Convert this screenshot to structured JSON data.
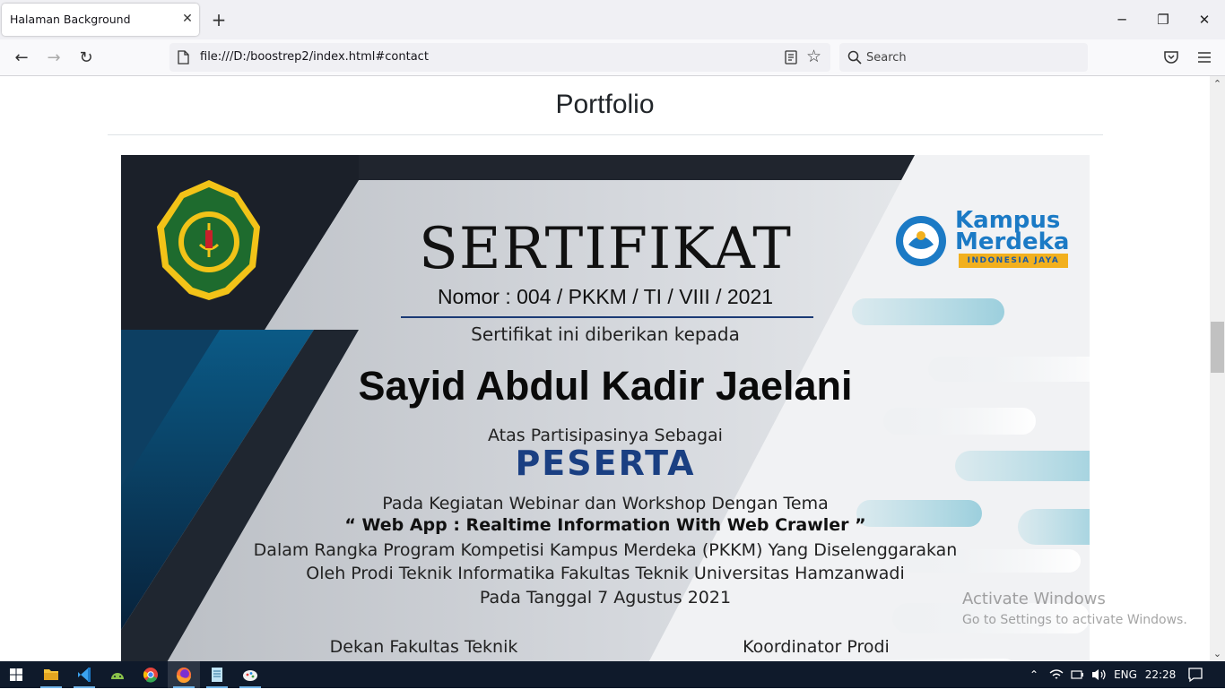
{
  "browser": {
    "tab_title": "Halaman Background",
    "tab_close": "✕",
    "new_tab": "+",
    "url": "file:///D:/boostrep2/index.html#contact",
    "search_placeholder": "Search",
    "window_controls": {
      "minimize": "─",
      "restore": "❐",
      "close": "✕"
    },
    "nav": {
      "back": "←",
      "forward": "→",
      "reload": "↻"
    }
  },
  "page": {
    "heading": "Portfolio",
    "certificate": {
      "university": "UNIVERSITAS HAMZANWADI",
      "kampus_line1": "Kampus",
      "kampus_line2": "Merdeka",
      "kampus_tag": "INDONESIA JAYA",
      "title": "SERTIFIKAT",
      "nomor": "Nomor : 004 / PKKM / TI / VIII / 2021",
      "given_to": "Sertifikat ini diberikan kepada",
      "recipient": "Sayid Abdul Kadir Jaelani",
      "role_intro": "Atas Partisipasinya Sebagai",
      "role": "PESERTA",
      "line1": "Pada Kegiatan Webinar dan Workshop Dengan Tema",
      "line2": "“ Web App : Realtime Information With Web Crawler ”",
      "line3": "Dalam Rangka Program Kompetisi Kampus Merdeka (PKKM) Yang Diselenggarakan",
      "line4": "Oleh Prodi Teknik Informatika Fakultas Teknik Universitas Hamzanwadi",
      "line5": "Pada Tanggal 7 Agustus 2021",
      "signer1": "Dekan Fakultas Teknik",
      "signer2": "Koordinator Prodi"
    }
  },
  "watermark": {
    "line1": "Activate Windows",
    "line2": "Go to Settings to activate Windows."
  },
  "taskbar": {
    "apps": [
      "start-icon",
      "file-explorer-icon",
      "vscode-icon",
      "android-studio-icon",
      "chrome-icon",
      "firefox-icon",
      "notepad-icon",
      "paint-icon"
    ],
    "language": "ENG",
    "time": "22:28"
  },
  "colors": {
    "accent": "#1a3f82",
    "taskbar": "#0f1a2b",
    "kampus_blue": "#1b7ac5"
  }
}
